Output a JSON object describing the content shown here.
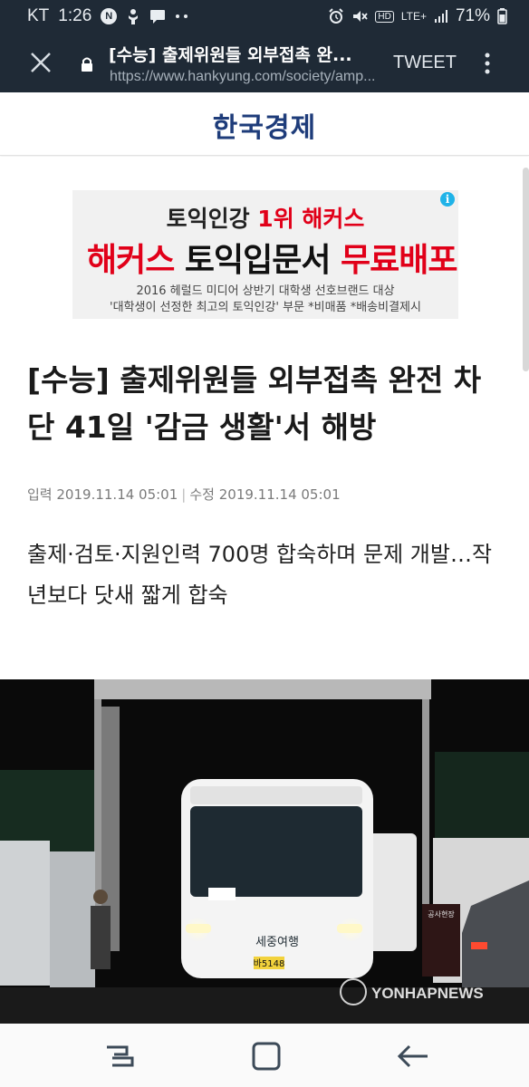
{
  "status_bar": {
    "carrier": "KT",
    "time": "1:26",
    "notification_icons": [
      "n-badge-icon",
      "voice-search-icon",
      "message-icon",
      "more-dots-icon"
    ],
    "hd_badge": "HD",
    "network": "LTE+",
    "battery": "71%"
  },
  "browser": {
    "title": "[수능] 출제위원들 외부접촉 완...",
    "url": "https://www.hankyung.com/society/amp...",
    "tweet_label": "TWEET"
  },
  "site": {
    "logo": "한국경제"
  },
  "ad": {
    "line1_prefix": "토익인강 ",
    "line1_highlight": "1위 해커스",
    "line2_part1": "해커스",
    "line2_part2": " 토익입문서 ",
    "line2_part3": "무료배포",
    "line3": "2016 헤럴드 미디어 상반기 대학생 선호브랜드 대상",
    "line4": "'대학생이 선정한 최고의 토익인강' 부문 *비매품 *배송비결제시",
    "info_glyph": "i"
  },
  "article": {
    "headline": "[수능] 출제위원들 외부접촉 완전 차단 41일 '감금 생활'서 해방",
    "input_label": "입력",
    "input_date": "2019.11.14 05:01",
    "separator": "|",
    "edit_label": "수정",
    "edit_date": "2019.11.14 05:01",
    "subheadline": "출제·검토·지원인력 700명 합숙하며 문제 개발…작년보다 닷새 짧게 합숙"
  },
  "photo": {
    "bus_logo": "세중여행",
    "plate": "바5148",
    "sign": "공사현장",
    "watermark": "YONHAPNEWS"
  },
  "colors": {
    "status_bg": "#1f2a36",
    "logo": "#1e3c7a",
    "ad_red": "#e10019"
  }
}
